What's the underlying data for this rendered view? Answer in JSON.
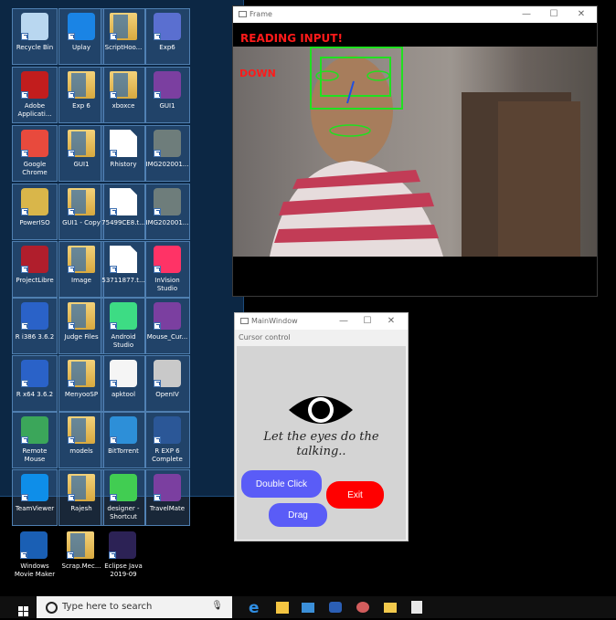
{
  "desktop_icons": [
    {
      "label": "Recycle Bin",
      "icon": "recycle-bin-icon"
    },
    {
      "label": "Uplay",
      "icon": "uplay-icon"
    },
    {
      "label": "ScriptHoo...",
      "icon": "folder-icon"
    },
    {
      "label": "Exp6",
      "icon": "r-logo-icon"
    },
    {
      "label": "Adobe Applicati...",
      "icon": "adobe-icon"
    },
    {
      "label": "Exp 6",
      "icon": "folder-icon"
    },
    {
      "label": "xboxce",
      "icon": "folder-icon"
    },
    {
      "label": "GUI1",
      "icon": "winrar-icon"
    },
    {
      "label": "Google Chrome",
      "icon": "chrome-icon"
    },
    {
      "label": "GUI1",
      "icon": "folder-icon"
    },
    {
      "label": "Rhistory",
      "icon": "document-icon"
    },
    {
      "label": "IMG202001...",
      "icon": "image-icon"
    },
    {
      "label": "PowerISO",
      "icon": "poweriso-icon"
    },
    {
      "label": "GUI1 - Copy",
      "icon": "folder-icon"
    },
    {
      "label": "75499CE8.t...",
      "icon": "document-icon"
    },
    {
      "label": "IMG202001...",
      "icon": "image-icon"
    },
    {
      "label": "ProjectLibre",
      "icon": "projectlibre-icon"
    },
    {
      "label": "Image",
      "icon": "folder-icon"
    },
    {
      "label": "53711877.t...",
      "icon": "document-icon"
    },
    {
      "label": "InVision Studio",
      "icon": "invision-icon"
    },
    {
      "label": "R i386 3.6.2",
      "icon": "r-icon"
    },
    {
      "label": "Judge Files",
      "icon": "folder-icon"
    },
    {
      "label": "Android Studio",
      "icon": "android-studio-icon"
    },
    {
      "label": "Mouse_Cur...",
      "icon": "winrar-icon"
    },
    {
      "label": "R x64 3.6.2",
      "icon": "r-icon"
    },
    {
      "label": "MenyooSP",
      "icon": "folder-icon"
    },
    {
      "label": "apktool",
      "icon": "java-icon"
    },
    {
      "label": "OpenIV",
      "icon": "openiv-icon"
    },
    {
      "label": "Remote Mouse",
      "icon": "remote-mouse-icon"
    },
    {
      "label": "models",
      "icon": "folder-icon"
    },
    {
      "label": "BitTorrent",
      "icon": "bittorrent-icon"
    },
    {
      "label": "R EXP 6 Complete",
      "icon": "word-icon"
    },
    {
      "label": "TeamViewer",
      "icon": "teamviewer-icon"
    },
    {
      "label": "Rajesh",
      "icon": "folder-icon"
    },
    {
      "label": "designer - Shortcut",
      "icon": "designer-icon"
    },
    {
      "label": "TravelMate",
      "icon": "winrar-icon"
    }
  ],
  "desktop_icons_bottom": [
    {
      "label": "Windows Movie Maker",
      "icon": "movie-maker-icon"
    },
    {
      "label": "Scrap.Mec...",
      "icon": "folder-icon"
    },
    {
      "label": "Eclipse Java 2019-09",
      "icon": "eclipse-icon"
    }
  ],
  "frame_window": {
    "title": "Frame",
    "overlay_title": "READING INPUT!",
    "direction": "DOWN"
  },
  "main_window": {
    "title": "MainWindow",
    "menu": "Cursor control",
    "tagline": "Let the eyes do the talking..",
    "buttons": {
      "double_click": "Double Click",
      "exit": "Exit",
      "drag": "Drag"
    }
  },
  "taskbar": {
    "search_placeholder": "Type here to search"
  }
}
